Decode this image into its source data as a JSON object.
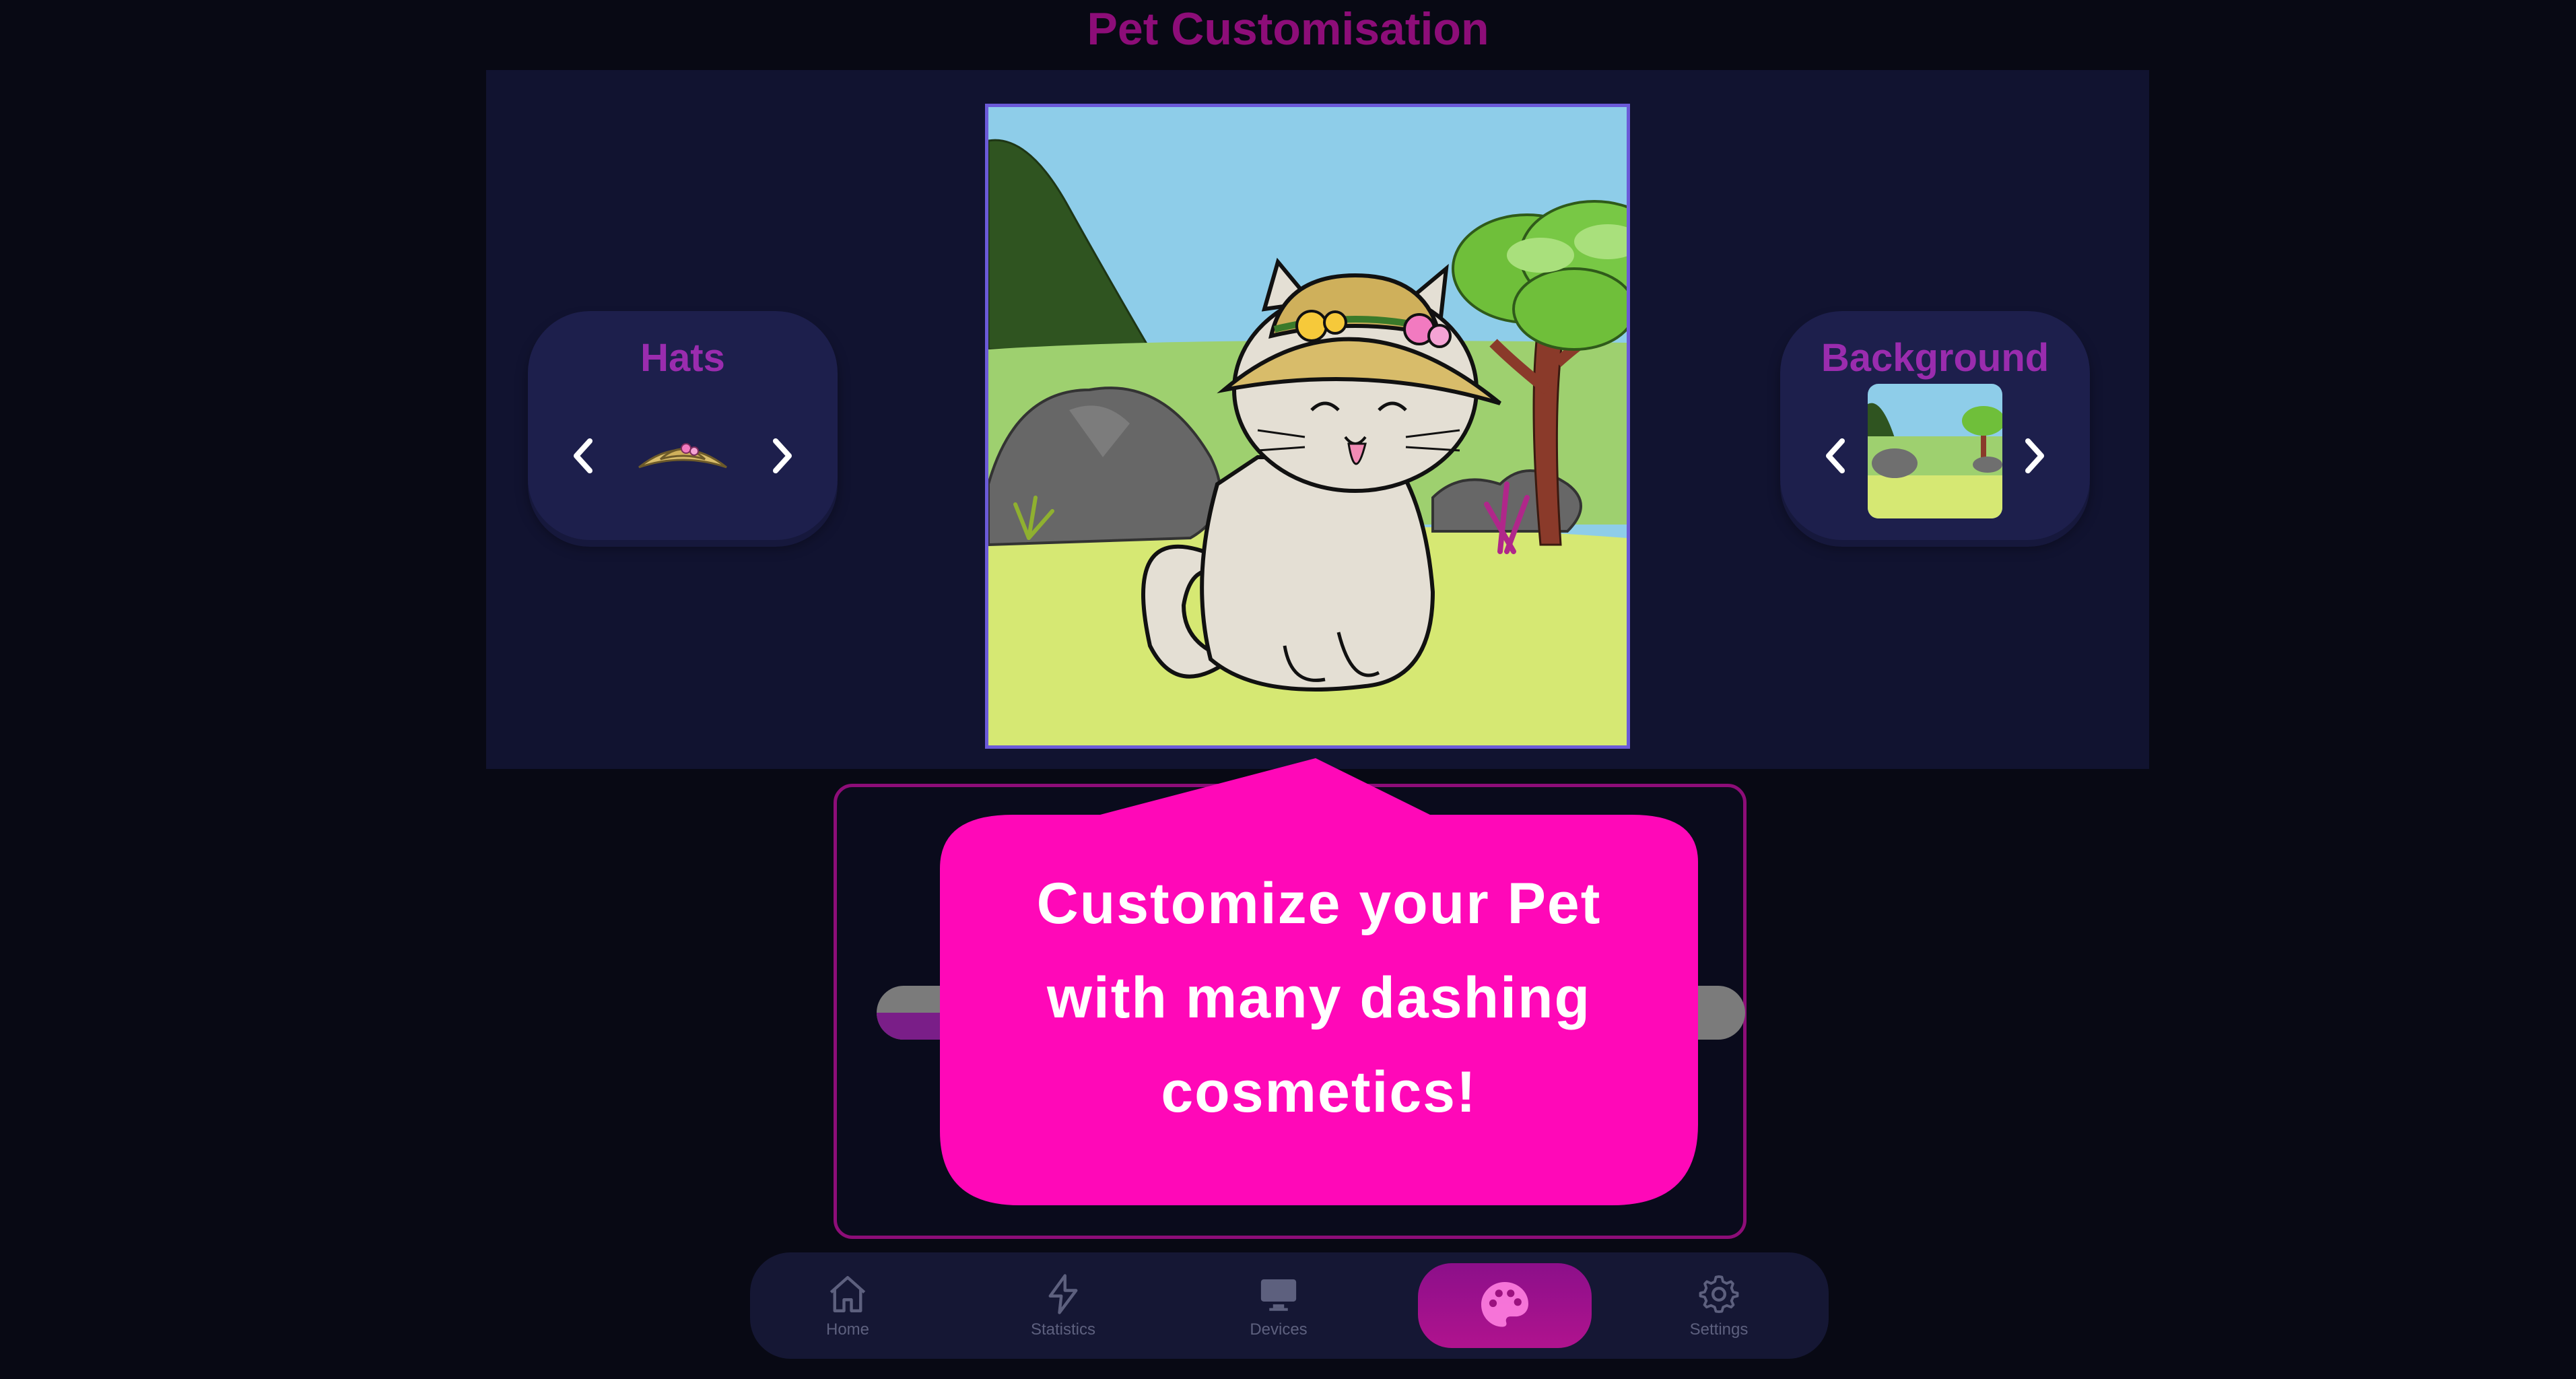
{
  "page": {
    "title": "Pet Customisation"
  },
  "hats": {
    "label": "Hats",
    "current_icon": "straw-hat-icon"
  },
  "background": {
    "label": "Background",
    "current_icon": "meadow-scene-thumbnail"
  },
  "preview": {
    "pet_icon": "cat-with-straw-hat"
  },
  "progress": {
    "value": 0.12
  },
  "promo": {
    "line1": "Customize your Pet",
    "line2": "with many dashing",
    "line3": "cosmetics!"
  },
  "nav": [
    {
      "label": "Home",
      "icon": "home-icon"
    },
    {
      "label": "Statistics",
      "icon": "lightning-icon"
    },
    {
      "label": "Devices",
      "icon": "monitor-icon"
    },
    {
      "label": "",
      "icon": "palette-icon",
      "active": true
    },
    {
      "label": "Settings",
      "icon": "gear-icon"
    }
  ],
  "colors": {
    "background": "#080914",
    "title": "#8d0d78",
    "accent": "#ff08b8",
    "panel": "#111330",
    "picker": "#1d1f4c",
    "label": "#9a2cae"
  }
}
